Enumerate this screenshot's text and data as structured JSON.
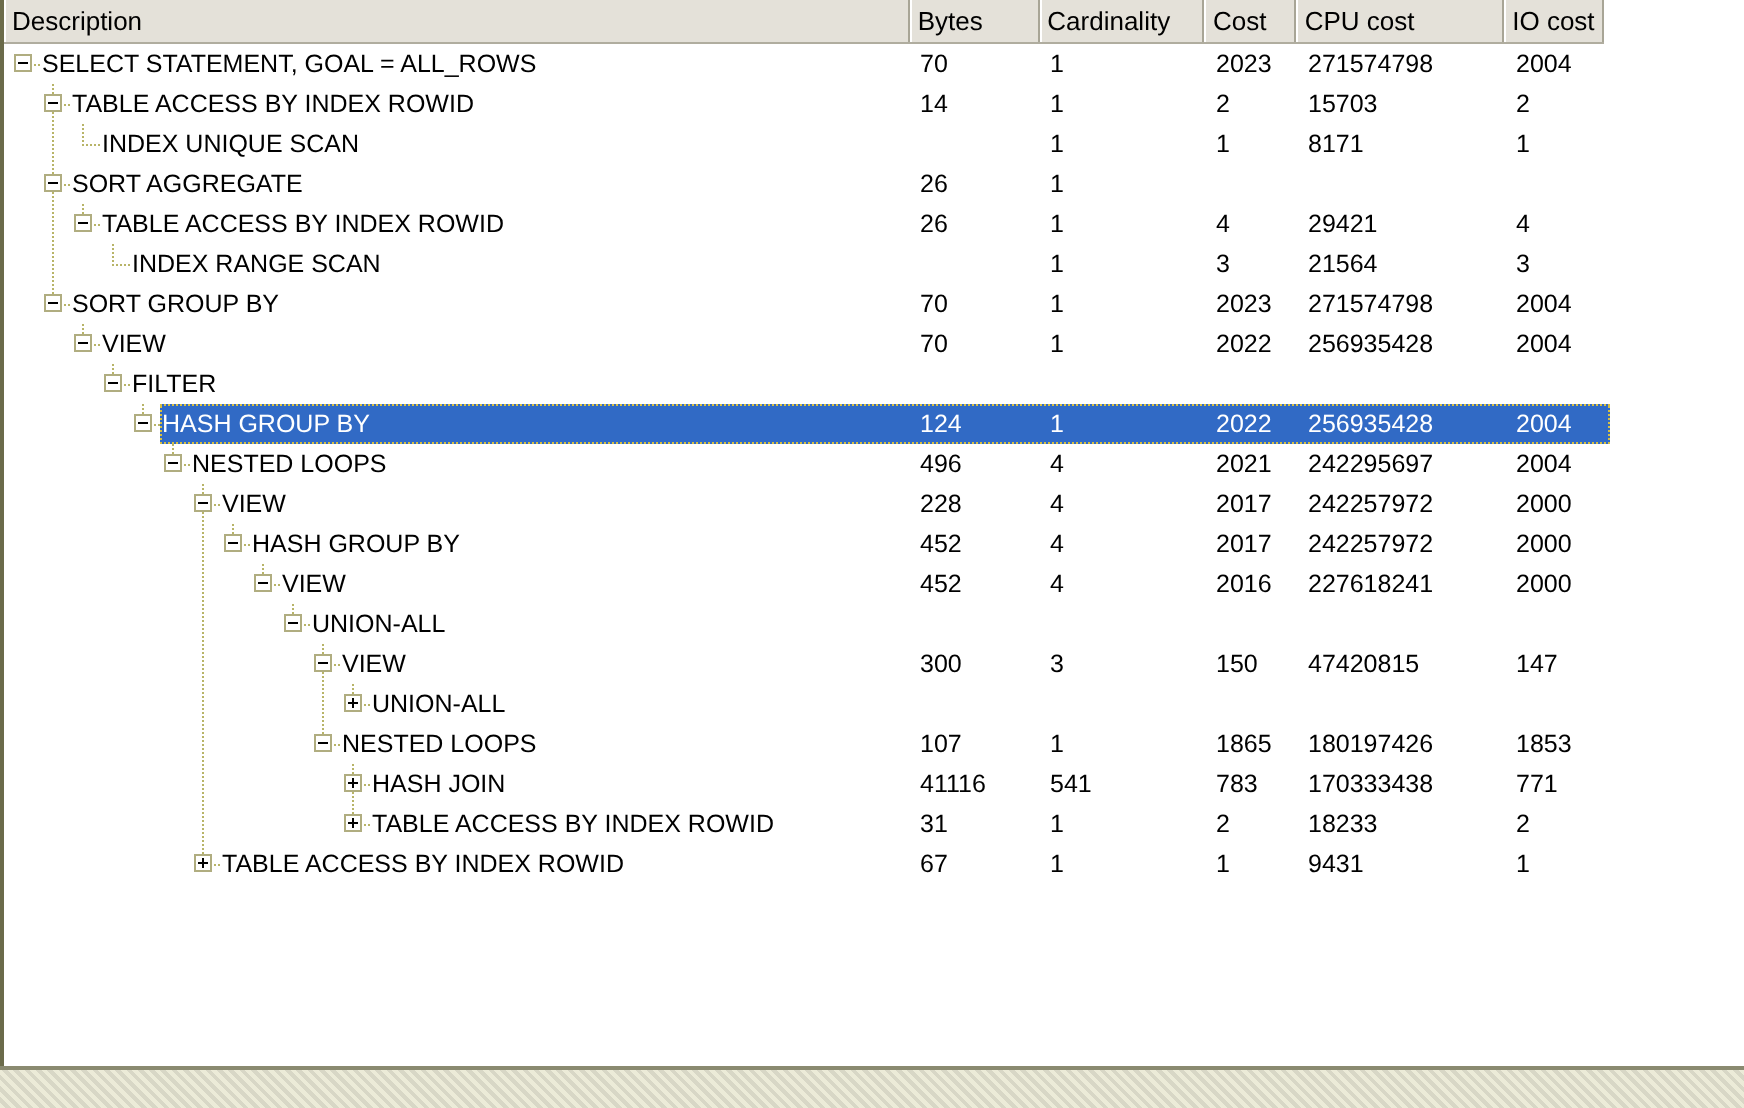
{
  "columns": [
    "Description",
    "Bytes",
    "Cardinality",
    "Cost",
    "CPU cost",
    "IO cost"
  ],
  "plan": [
    {
      "description": "SELECT STATEMENT, GOAL = ALL_ROWS",
      "bytes": "70",
      "cardinality": "1",
      "cost": "2023",
      "cpu_cost": "271574798",
      "io_cost": "2004",
      "expanded": true,
      "selected": false,
      "children": [
        {
          "description": "TABLE ACCESS BY INDEX ROWID",
          "bytes": "14",
          "cardinality": "1",
          "cost": "2",
          "cpu_cost": "15703",
          "io_cost": "2",
          "expanded": true,
          "selected": false,
          "children": [
            {
              "description": "INDEX UNIQUE SCAN",
              "cardinality": "1",
              "cost": "1",
              "cpu_cost": "8171",
              "io_cost": "1",
              "selected": false
            }
          ]
        },
        {
          "description": "SORT AGGREGATE",
          "bytes": "26",
          "cardinality": "1",
          "expanded": true,
          "selected": false,
          "children": [
            {
              "description": "TABLE ACCESS BY INDEX ROWID",
              "bytes": "26",
              "cardinality": "1",
              "cost": "4",
              "cpu_cost": "29421",
              "io_cost": "4",
              "expanded": true,
              "selected": false,
              "children": [
                {
                  "description": "INDEX RANGE SCAN",
                  "cardinality": "1",
                  "cost": "3",
                  "cpu_cost": "21564",
                  "io_cost": "3",
                  "selected": false
                }
              ]
            }
          ]
        },
        {
          "description": "SORT GROUP BY",
          "bytes": "70",
          "cardinality": "1",
          "cost": "2023",
          "cpu_cost": "271574798",
          "io_cost": "2004",
          "expanded": true,
          "selected": false,
          "children": [
            {
              "description": "VIEW",
              "bytes": "70",
              "cardinality": "1",
              "cost": "2022",
              "cpu_cost": "256935428",
              "io_cost": "2004",
              "expanded": true,
              "selected": false,
              "children": [
                {
                  "description": "FILTER",
                  "expanded": true,
                  "selected": false,
                  "children": [
                    {
                      "description": "HASH GROUP BY",
                      "bytes": "124",
                      "cardinality": "1",
                      "cost": "2022",
                      "cpu_cost": "256935428",
                      "io_cost": "2004",
                      "expanded": true,
                      "selected": true,
                      "children": [
                        {
                          "description": "NESTED LOOPS",
                          "bytes": "496",
                          "cardinality": "4",
                          "cost": "2021",
                          "cpu_cost": "242295697",
                          "io_cost": "2004",
                          "expanded": true,
                          "selected": false,
                          "children": [
                            {
                              "description": "VIEW",
                              "bytes": "228",
                              "cardinality": "4",
                              "cost": "2017",
                              "cpu_cost": "242257972",
                              "io_cost": "2000",
                              "expanded": true,
                              "selected": false,
                              "children": [
                                {
                                  "description": "HASH GROUP BY",
                                  "bytes": "452",
                                  "cardinality": "4",
                                  "cost": "2017",
                                  "cpu_cost": "242257972",
                                  "io_cost": "2000",
                                  "expanded": true,
                                  "selected": false,
                                  "children": [
                                    {
                                      "description": "VIEW",
                                      "bytes": "452",
                                      "cardinality": "4",
                                      "cost": "2016",
                                      "cpu_cost": "227618241",
                                      "io_cost": "2000",
                                      "expanded": true,
                                      "selected": false,
                                      "children": [
                                        {
                                          "description": "UNION-ALL",
                                          "expanded": true,
                                          "selected": false,
                                          "children": [
                                            {
                                              "description": "VIEW",
                                              "bytes": "300",
                                              "cardinality": "3",
                                              "cost": "150",
                                              "cpu_cost": "47420815",
                                              "io_cost": "147",
                                              "expanded": true,
                                              "selected": false,
                                              "children": [
                                                {
                                                  "description": "UNION-ALL",
                                                  "expanded": false,
                                                  "selected": false
                                                }
                                              ]
                                            },
                                            {
                                              "description": "NESTED LOOPS",
                                              "bytes": "107",
                                              "cardinality": "1",
                                              "cost": "1865",
                                              "cpu_cost": "180197426",
                                              "io_cost": "1853",
                                              "expanded": true,
                                              "selected": false,
                                              "children": [
                                                {
                                                  "description": "HASH JOIN",
                                                  "bytes": "41116",
                                                  "cardinality": "541",
                                                  "cost": "783",
                                                  "cpu_cost": "170333438",
                                                  "io_cost": "771",
                                                  "expanded": false,
                                                  "selected": false
                                                },
                                                {
                                                  "description": "TABLE ACCESS BY INDEX ROWID",
                                                  "bytes": "31",
                                                  "cardinality": "1",
                                                  "cost": "2",
                                                  "cpu_cost": "18233",
                                                  "io_cost": "2",
                                                  "expanded": false,
                                                  "selected": false
                                                }
                                              ]
                                            }
                                          ]
                                        }
                                      ]
                                    }
                                  ]
                                }
                              ]
                            },
                            {
                              "description": "TABLE ACCESS BY INDEX ROWID",
                              "bytes": "67",
                              "cardinality": "1",
                              "cost": "1",
                              "cpu_cost": "9431",
                              "io_cost": "1",
                              "expanded": false,
                              "selected": false
                            }
                          ]
                        }
                      ]
                    }
                  ]
                }
              ]
            }
          ]
        }
      ]
    }
  ]
}
